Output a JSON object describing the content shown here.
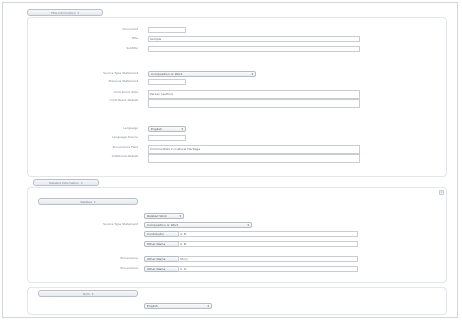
{
  "top_tab": {
    "label": "Title Information"
  },
  "form": {
    "document_label": "Document",
    "title_label": "Title",
    "title_value": "Sample",
    "subtitle_label": "Subtitle",
    "source_type_label": "Source Type Statement",
    "source_type_value": "Composition or Work",
    "prev_statement_label": "Previous Statement",
    "contributor_role_label": "Contributor Role",
    "contributor_role_value": "Person (author)",
    "contributor_label": "Contributor Details",
    "language_label": "Language",
    "language_value": "English",
    "lang_source_label": "Language Source",
    "provenance_label": "Provenance Field",
    "provenance_value": "Communities in Cultural Heritage",
    "extra_label": "Additional Details"
  },
  "middle_tab": {
    "label": "Related Information"
  },
  "group1": {
    "tab_label": "Related",
    "type_select": "Related Work",
    "source_type_label": "Source Type Statement",
    "source_type_value": "Composition or Work",
    "row1_select": "Contributor",
    "row1_value": "A. B.",
    "row2_select": "Other Name",
    "row2_value": "A. B.",
    "prov_label": "Provenance",
    "prov_select": "Other Name",
    "prov_value": "Story",
    "prov2_label": "Provenance",
    "prov2_select": "Other Name",
    "prov2_value": "C. D."
  },
  "bottom_tab": {
    "label": "Term"
  },
  "bottom": {
    "select": "English"
  }
}
